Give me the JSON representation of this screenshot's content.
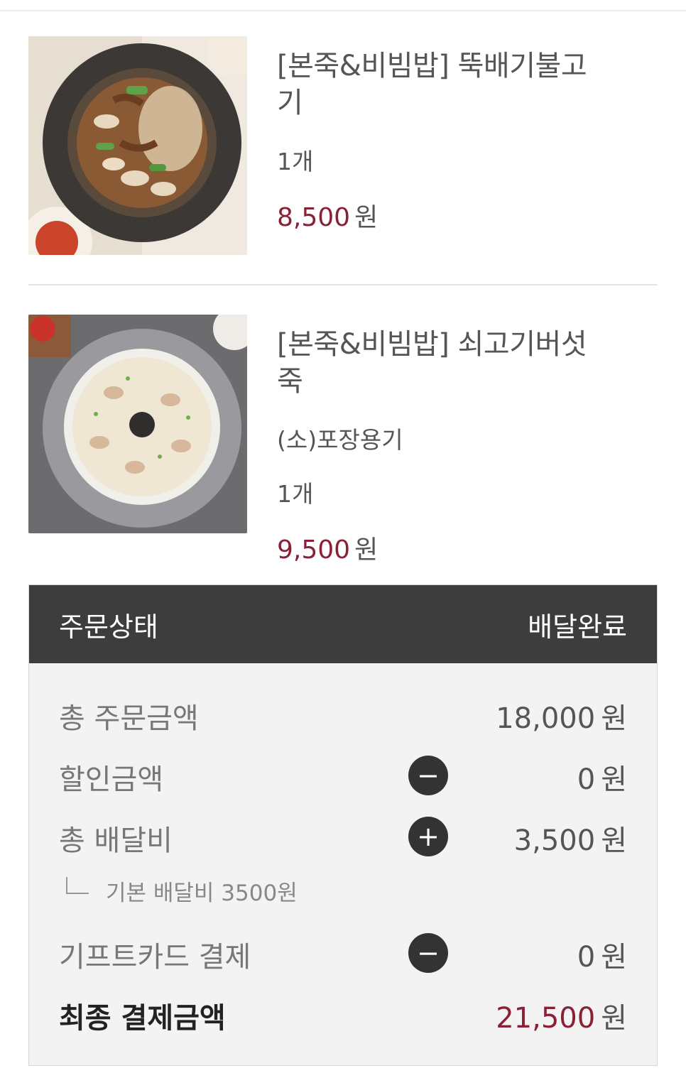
{
  "items": [
    {
      "name": "[본죽&비빔밥] 뚝배기불고기",
      "name_line1": "[본죽&비빔밥] 뚝배기불고",
      "name_line2": "기",
      "quantity": "1개",
      "price": "8,500",
      "currency": "원"
    },
    {
      "name": "[본죽&비빔밥] 쇠고기버섯죽",
      "name_line1": "[본죽&비빔밥] 쇠고기버섯",
      "name_line2": "죽",
      "option": "(소)포장용기",
      "quantity": "1개",
      "price": "9,500",
      "currency": "원"
    }
  ],
  "summary": {
    "status_label": "주문상태",
    "status_value": "배달완료",
    "total_order_label": "총 주문금액",
    "total_order_value": "18,000",
    "discount_label": "할인금액",
    "discount_value": "0",
    "delivery_label": "총 배달비",
    "delivery_value": "3,500",
    "delivery_sub": "기본 배달비 3500원",
    "giftcard_label": "기프트카드 결제",
    "giftcard_value": "0",
    "final_label": "최종 결제금액",
    "final_value": "21,500",
    "currency": "원",
    "minus_symbol": "−",
    "plus_symbol": "+"
  },
  "colors": {
    "price_accent": "#8a2036",
    "status_bar_bg": "#3d3d3d",
    "summary_bg": "#f3f3f3"
  },
  "icons": [
    "minus-circle-icon",
    "plus-circle-icon",
    "sub-item-corner-icon"
  ]
}
